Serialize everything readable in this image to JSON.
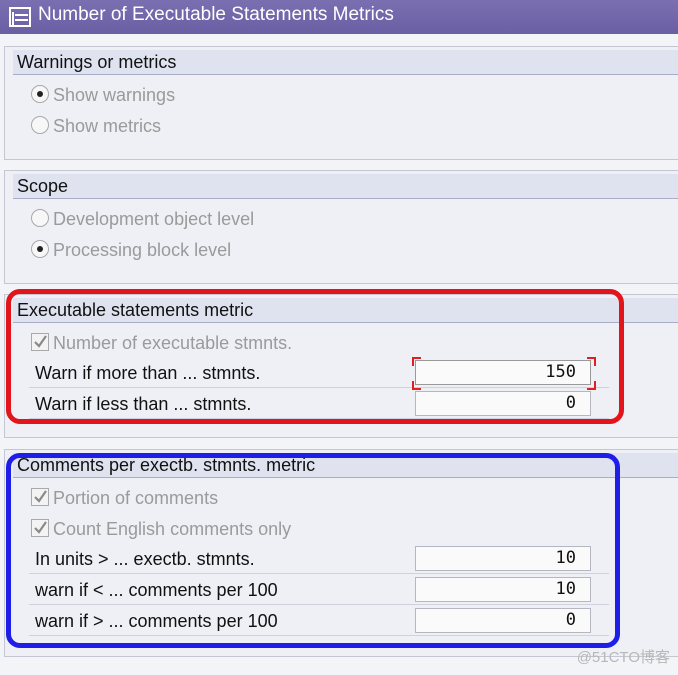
{
  "window": {
    "title": "Number of Executable Statements Metrics"
  },
  "groups": {
    "warnings": {
      "title": "Warnings or metrics",
      "options": [
        {
          "label": "Show warnings",
          "selected": true
        },
        {
          "label": "Show metrics",
          "selected": false
        }
      ]
    },
    "scope": {
      "title": "Scope",
      "options": [
        {
          "label": "Development object level",
          "selected": false
        },
        {
          "label": "Processing block level",
          "selected": true
        }
      ]
    },
    "exec": {
      "title": "Executable statements metric",
      "checkbox": {
        "label": "Number of executable stmnts.",
        "checked": true
      },
      "fields": [
        {
          "label": "Warn if more than ... stmnts.",
          "value": "150"
        },
        {
          "label": "Warn if less than ... stmnts.",
          "value": "0"
        }
      ]
    },
    "comments": {
      "title": "Comments per exectb. stmnts. metric",
      "checkboxes": [
        {
          "label": "Portion of comments",
          "checked": true
        },
        {
          "label": "Count English comments only",
          "checked": true
        }
      ],
      "fields": [
        {
          "label": "In units > ... exectb. stmnts.",
          "value": "10"
        },
        {
          "label": "warn if < ... comments per 100",
          "value": "10"
        },
        {
          "label": "warn if > ... comments per 100",
          "value": "0"
        }
      ]
    }
  },
  "highlight_colors": {
    "exec": "#e2141c",
    "comments": "#1e1ee8"
  },
  "watermark": "@51CTO博客"
}
